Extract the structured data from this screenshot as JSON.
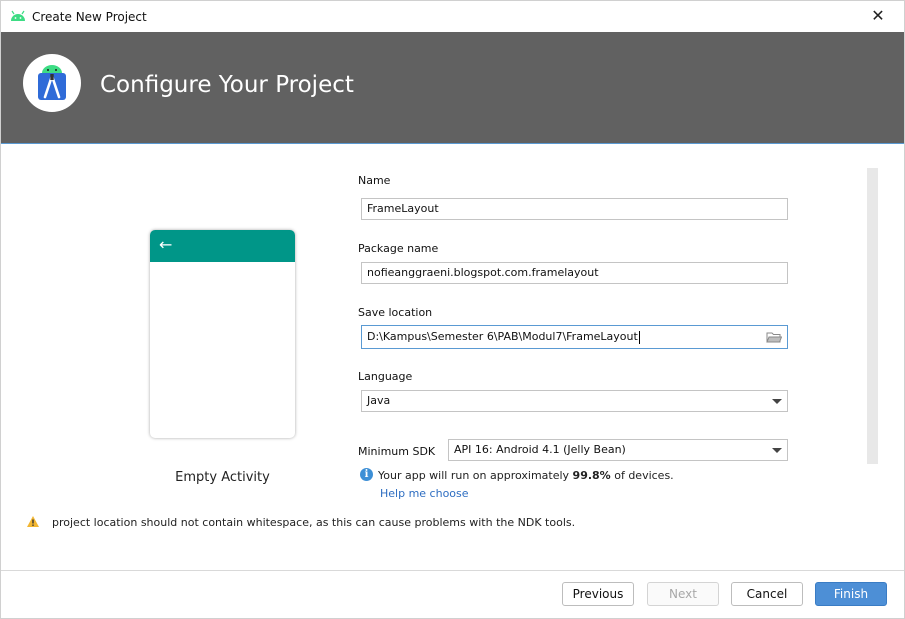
{
  "window": {
    "title": "Create New Project"
  },
  "header": {
    "title": "Configure Your Project"
  },
  "template": {
    "label": "Empty Activity",
    "toolbar_color": "#009688"
  },
  "form": {
    "name_label": "Name",
    "name_value": "FrameLayout",
    "package_label": "Package name",
    "package_value": "nofieanggraeni.blogspot.com.framelayout",
    "location_label": "Save location",
    "location_value": "D:\\Kampus\\Semester 6\\PAB\\Modul7\\FrameLayout",
    "language_label": "Language",
    "language_value": "Java",
    "sdk_label": "Minimum SDK",
    "sdk_value": "API 16: Android 4.1 (Jelly Bean)",
    "info_prefix": "Your app will run on approximately ",
    "info_percent": "99.8%",
    "info_suffix": " of devices.",
    "help_link": "Help me choose"
  },
  "warning": {
    "text": "project location should not contain whitespace, as this can cause problems with the NDK tools."
  },
  "buttons": {
    "previous": "Previous",
    "next": "Next",
    "cancel": "Cancel",
    "finish": "Finish"
  },
  "colors": {
    "header_bg": "#616161",
    "accent": "#4d8fd6",
    "warning": "#f2b632"
  }
}
